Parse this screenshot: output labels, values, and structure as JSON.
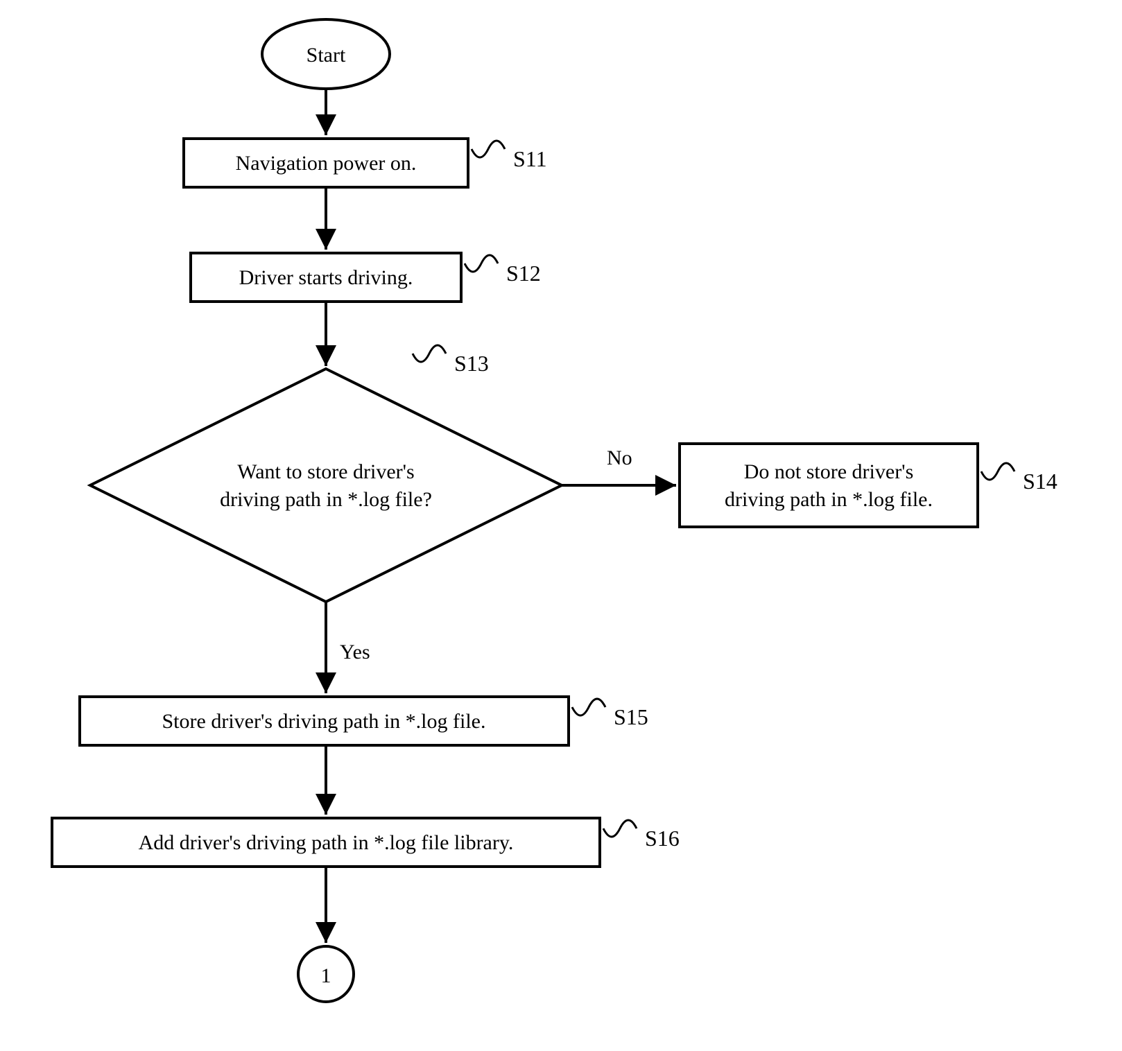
{
  "chart_data": {
    "type": "flowchart",
    "nodes": [
      {
        "id": "start",
        "kind": "terminator",
        "text": "Start"
      },
      {
        "id": "s11",
        "kind": "process",
        "text": "Navigation power on.",
        "label": "S11"
      },
      {
        "id": "s12",
        "kind": "process",
        "text": "Driver starts driving.",
        "label": "S12"
      },
      {
        "id": "s13",
        "kind": "decision",
        "text": "Want to store driver's driving path in *.log file?",
        "label": "S13"
      },
      {
        "id": "s14",
        "kind": "process",
        "text": "Do not store driver's driving path in *.log file.",
        "label": "S14"
      },
      {
        "id": "s15",
        "kind": "process",
        "text": "Store driver's driving path in *.log file.",
        "label": "S15"
      },
      {
        "id": "s16",
        "kind": "process",
        "text": "Add driver's driving path in *.log file library.",
        "label": "S16"
      },
      {
        "id": "conn1",
        "kind": "connector",
        "text": "1"
      }
    ],
    "edges": [
      {
        "from": "start",
        "to": "s11"
      },
      {
        "from": "s11",
        "to": "s12"
      },
      {
        "from": "s12",
        "to": "s13"
      },
      {
        "from": "s13",
        "to": "s14",
        "label": "No"
      },
      {
        "from": "s13",
        "to": "s15",
        "label": "Yes"
      },
      {
        "from": "s15",
        "to": "s16"
      },
      {
        "from": "s16",
        "to": "conn1"
      }
    ]
  },
  "nodes": {
    "start": {
      "text": "Start"
    },
    "s11": {
      "text": "Navigation power on.",
      "label": "S11"
    },
    "s12": {
      "text": "Driver starts driving.",
      "label": "S12"
    },
    "s13": {
      "line1": "Want to store driver's",
      "line2": "driving path in *.log file?",
      "label": "S13"
    },
    "s14": {
      "line1": "Do not store driver's",
      "line2": "driving path in *.log file.",
      "label": "S14"
    },
    "s15": {
      "text": "Store driver's driving path in *.log file.",
      "label": "S15"
    },
    "s16": {
      "text": "Add driver's driving path in *.log file library.",
      "label": "S16"
    },
    "conn1": {
      "text": "1"
    }
  },
  "branches": {
    "no": "No",
    "yes": "Yes"
  }
}
